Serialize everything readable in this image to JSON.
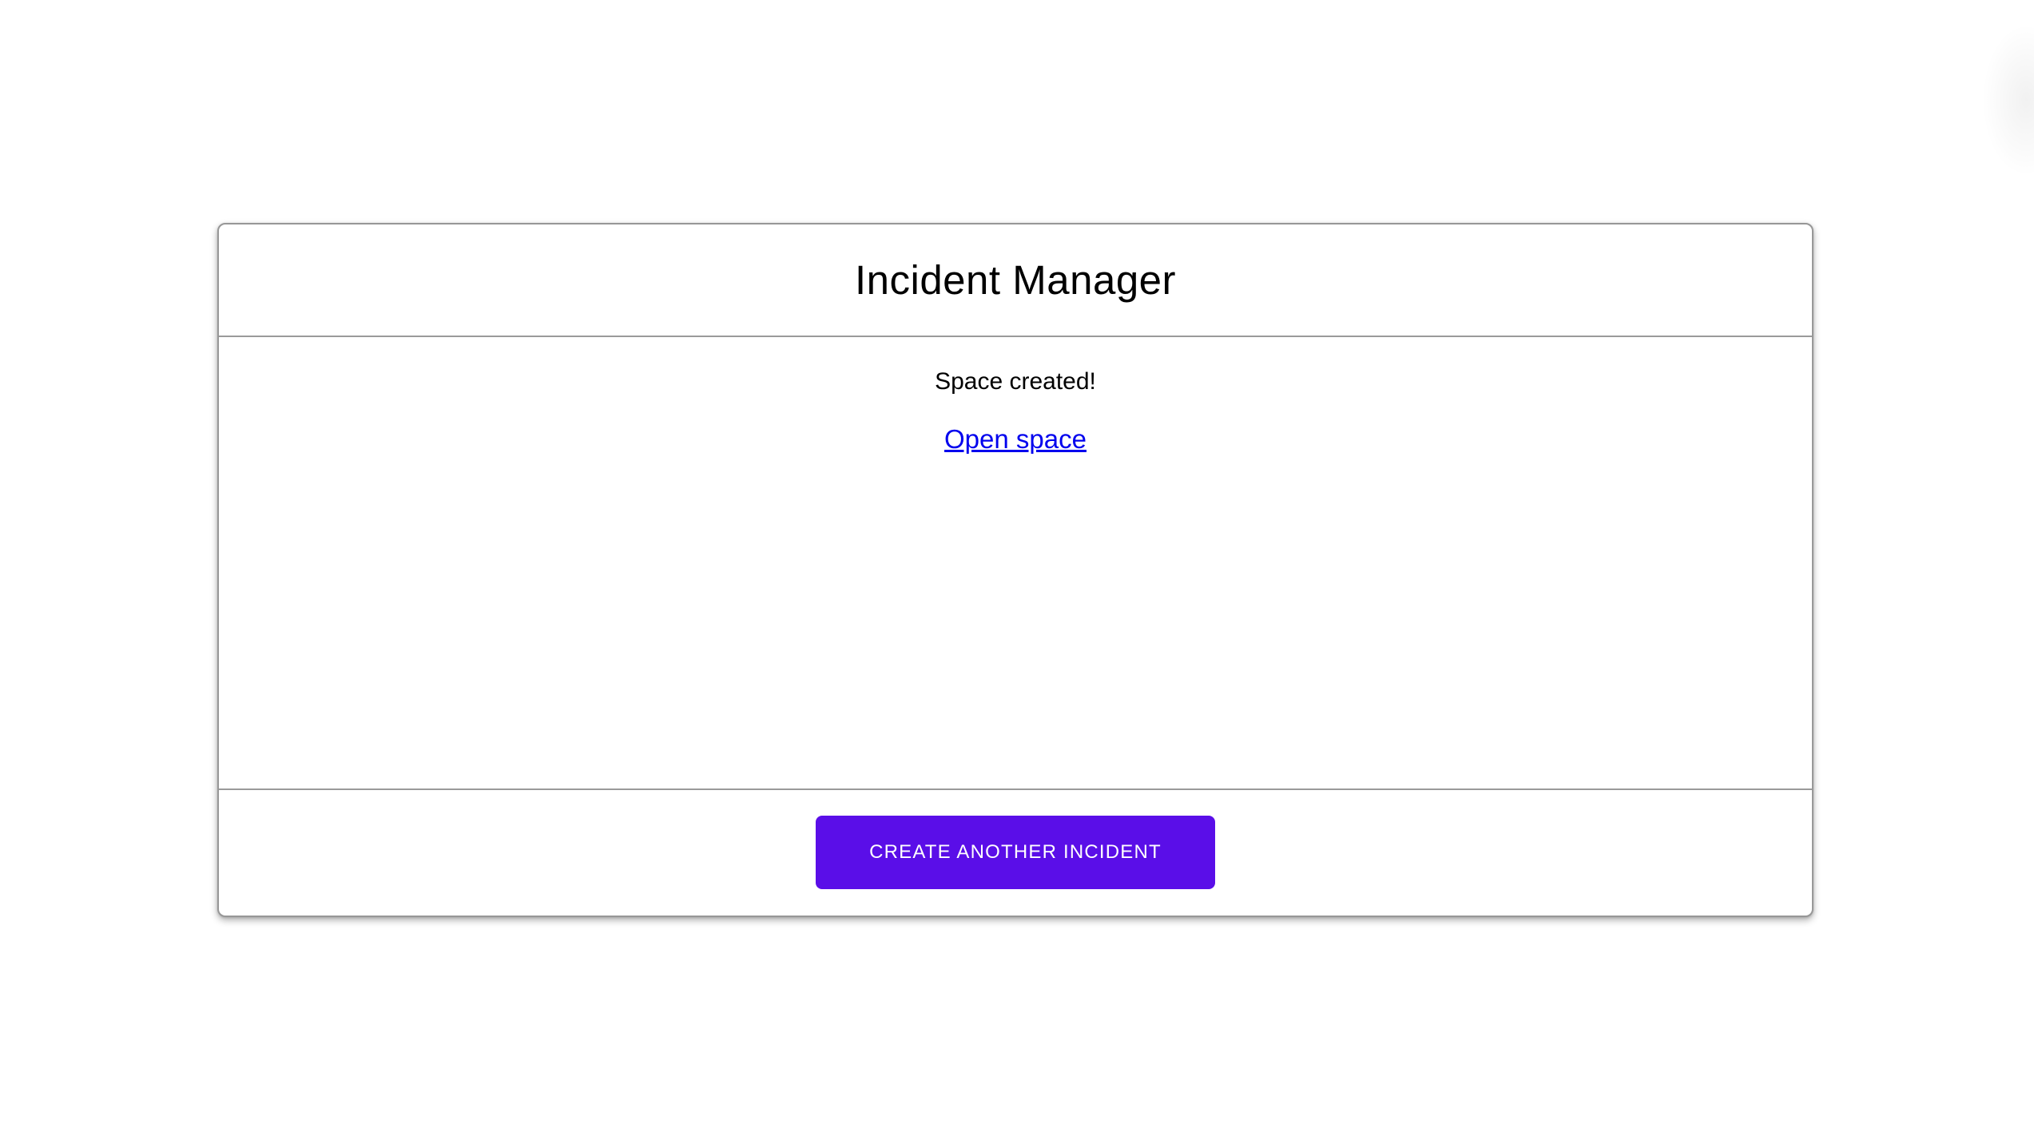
{
  "app": {
    "title": "Incident Manager"
  },
  "card": {
    "status_message": "Space created!",
    "link_label": "Open space",
    "footer": {
      "create_button_label": "CREATE ANOTHER INCIDENT"
    }
  },
  "colors": {
    "button_background": "#5a0ee8",
    "button_text": "#ffffff",
    "link": "#0000ee",
    "card_border": "#979797",
    "divider": "#9a9a9a",
    "text": "#000000",
    "page_background": "#ffffff"
  }
}
